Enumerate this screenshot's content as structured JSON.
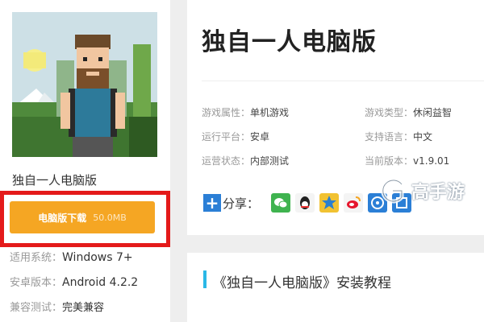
{
  "game": {
    "name": "独自一人电脑版",
    "download_label": "电脑版下载",
    "download_size": "50.0MB"
  },
  "specs": [
    {
      "k": "适用系统：",
      "v": "Windows 7+"
    },
    {
      "k": "安卓版本：",
      "v": "Android 4.2.2"
    },
    {
      "k": "兼容测试：",
      "v": "完美兼容"
    }
  ],
  "info": {
    "title": "独自一人电脑版",
    "attributes": [
      {
        "k": "游戏属性：",
        "v": "单机游戏"
      },
      {
        "k": "游戏类型：",
        "v": "休闲益智"
      },
      {
        "k": "运行平台：",
        "v": "安卓"
      },
      {
        "k": "支持语言：",
        "v": "中文"
      },
      {
        "k": "运营状态：",
        "v": "内部测试"
      },
      {
        "k": "当前版本：",
        "v": "v1.9.01"
      }
    ],
    "share_label": "分享：",
    "share_plus": "+"
  },
  "tutorial": {
    "title": "《独自一人电脑版》安装教程"
  },
  "watermark": {
    "text": "高手游"
  },
  "colors": {
    "download_button": "#f5a623",
    "highlight_frame": "#e41a1a",
    "accent": "#2ab8e6",
    "share_blue": "#2b7fd6"
  }
}
